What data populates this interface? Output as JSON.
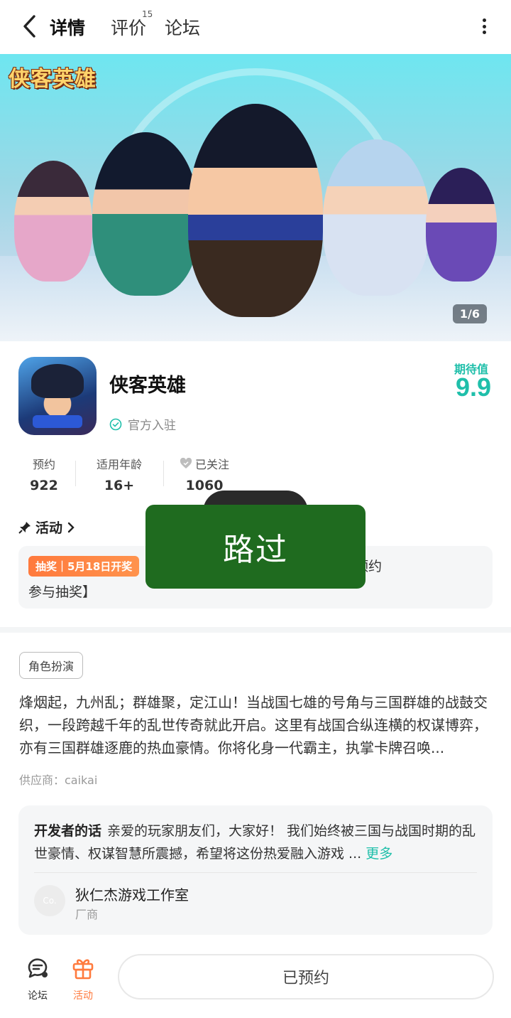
{
  "nav": {
    "tabs": [
      {
        "label": "详情"
      },
      {
        "label": "评价",
        "count": "15"
      },
      {
        "label": "论坛"
      }
    ]
  },
  "banner": {
    "logo_text": "侠客英雄",
    "counter": "1/6"
  },
  "app": {
    "name": "侠客英雄",
    "official_label": "官方入驻",
    "expect_label": "期待值",
    "expect_value": "9.9"
  },
  "stats": [
    {
      "label": "预约",
      "value": "922"
    },
    {
      "label": "适用年龄",
      "value": "16+"
    },
    {
      "label": "已关注",
      "value": "1060"
    }
  ],
  "activity": {
    "title": "活动",
    "badge": "抽奖｜5月18日开奖",
    "text_line1": "福利来袭，晒预约",
    "text_line2": "参与抽奖】"
  },
  "toast": {
    "text": "路过"
  },
  "details": {
    "tag": "角色扮演",
    "description": "烽烟起，九州乱；群雄聚，定江山！当战国七雄的号角与三国群雄的战鼓交织，一段跨越千年的乱世传奇就此开启。这里有战国合纵连横的权谋博弈，亦有三国群雄逐鹿的热血豪情。你将化身一代霸主，执掌卡牌召唤...",
    "supplier": "供应商：caikai"
  },
  "developer": {
    "heading": "开发者的话",
    "text": "亲爱的玩家朋友们，大家好！ 我们始终被三国与战国时期的乱世豪情、权谋智慧所震撼，希望将这份热爱融入游戏 ...",
    "more": "更多",
    "avatar_text": "Co.",
    "studio": "狄仁杰游戏工作室",
    "role": "厂商"
  },
  "bottom": {
    "forum_label": "论坛",
    "activity_label": "活动",
    "reserve_label": "已预约"
  },
  "colors": {
    "accent": "#1fbfaa",
    "orange": "#ff7a3d",
    "toast_bg": "#1f6b1f"
  }
}
